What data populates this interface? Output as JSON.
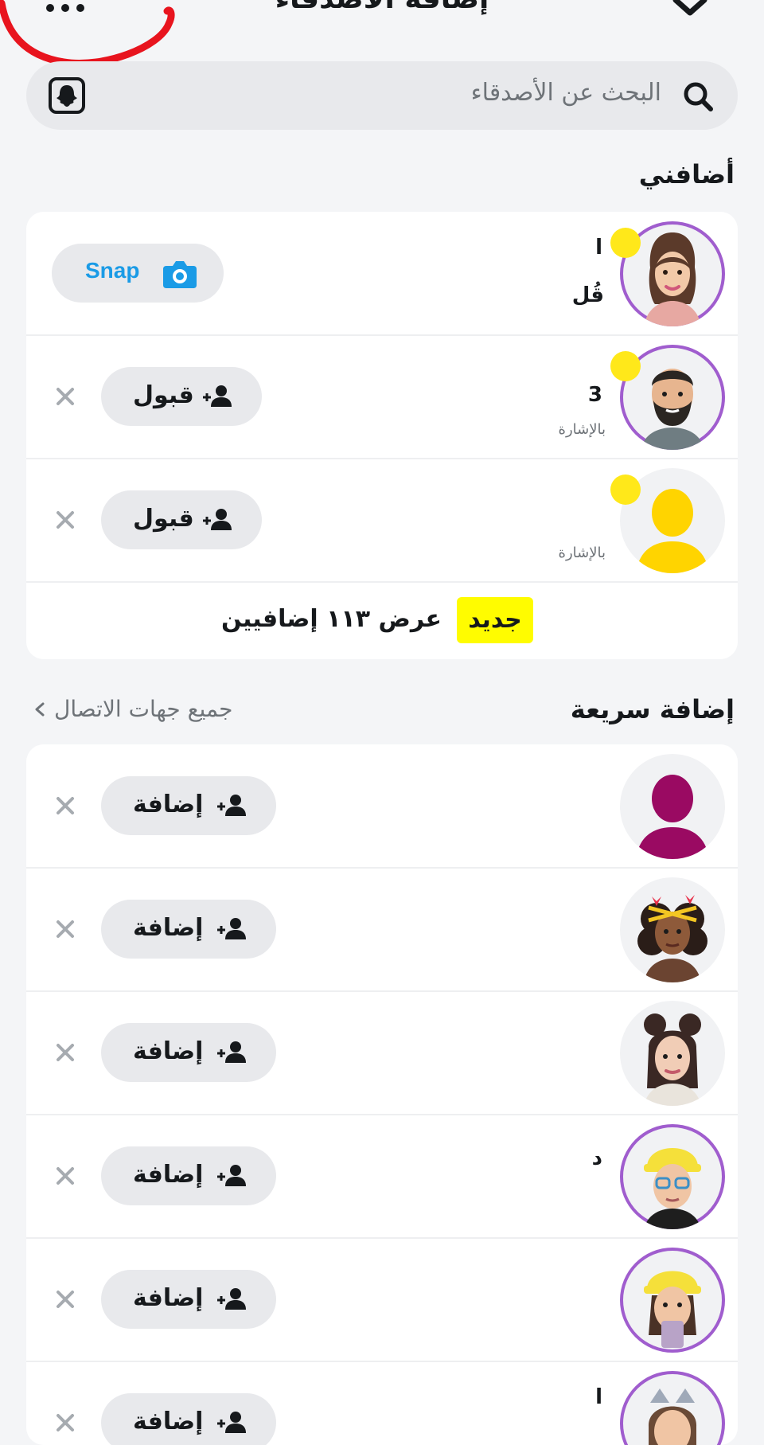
{
  "header": {
    "title": "إضافة الأصدقاء",
    "more_icon": "more-horizontal-icon",
    "collapse_icon": "chevron-down-icon"
  },
  "search": {
    "placeholder": "البحث عن الأصدقاء",
    "icon": "search-icon",
    "snapcode_icon": "snapcode-ghost-icon"
  },
  "added_me": {
    "title": "أضافني",
    "rows": [
      {
        "name_fragment": "ا",
        "sub_fragment": "قُل",
        "action": "Snap",
        "action_icon": "camera-icon"
      },
      {
        "name_fragment": "3",
        "sub_fragment": "بالإشارة",
        "action": "قبول",
        "action_icon": "add-user-icon"
      },
      {
        "name_fragment": "",
        "sub_fragment": "بالإشارة",
        "action": "قبول",
        "action_icon": "add-user-icon"
      }
    ],
    "new_badge": "جديد",
    "view_all": "عرض ١١٣ إضافيين"
  },
  "quick_add": {
    "title": "إضافة سريعة",
    "all_contacts": "جميع جهات الاتصال",
    "add_label": "إضافة",
    "rows": [
      {
        "name_fragment": ""
      },
      {
        "name_fragment": ""
      },
      {
        "name_fragment": ""
      },
      {
        "name_fragment": "د"
      },
      {
        "name_fragment": ""
      },
      {
        "name_fragment": "ا"
      }
    ]
  },
  "colors": {
    "background": "#F4F5F7",
    "card": "#FFFFFF",
    "pill": "#E8E9EC",
    "snap_blue": "#1A9BE6",
    "new_yellow": "#FFFC00",
    "unread_dot": "#FFE81A",
    "story_ring": "#A05DCE",
    "annotation_red": "#E8141E"
  }
}
